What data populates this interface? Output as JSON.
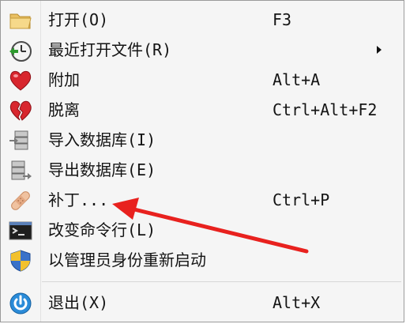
{
  "menu": {
    "items": [
      {
        "label": "打开(O)",
        "shortcut": "F3",
        "icon": "folder-open-icon"
      },
      {
        "label": "最近打开文件(R)",
        "shortcut": "",
        "icon": "recent-files-icon",
        "has_submenu": true
      },
      {
        "label": "附加",
        "shortcut": "Alt+A",
        "icon": "heart-attach-icon"
      },
      {
        "label": "脱离",
        "shortcut": "Ctrl+Alt+F2",
        "icon": "broken-heart-icon"
      },
      {
        "label": "导入数据库(I)",
        "shortcut": "",
        "icon": "database-import-icon"
      },
      {
        "label": "导出数据库(E)",
        "shortcut": "",
        "icon": "database-export-icon"
      },
      {
        "label": "补丁...",
        "shortcut": "Ctrl+P",
        "icon": "bandage-icon"
      },
      {
        "label": "改变命令行(L)",
        "shortcut": "",
        "icon": "terminal-icon"
      },
      {
        "label": "以管理员身份重新启动",
        "shortcut": "",
        "icon": "uac-shield-icon"
      },
      {
        "label": "退出(X)",
        "shortcut": "Alt+X",
        "icon": "power-icon"
      }
    ]
  },
  "annotation": {
    "arrow_color": "#e8211e",
    "points_to": "补丁..."
  }
}
